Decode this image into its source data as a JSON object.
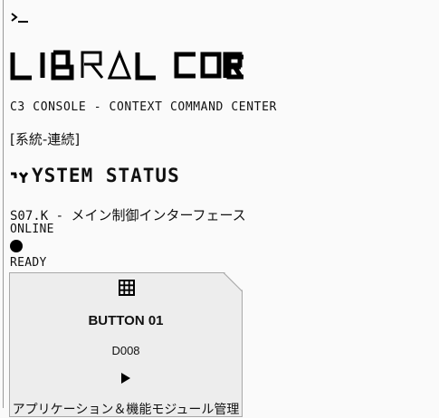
{
  "header": {
    "prompt_icon": "terminal-prompt-icon",
    "brand_logo_text": "LIBRAL CORE",
    "subtitle": "C3 CONSOLE - CONTEXT COMMAND CENTER",
    "tag": "[系統-連続]"
  },
  "system_status": {
    "heading": "YSTEM STATUS",
    "glyph_icon": "status-glyph-icon",
    "interface_code": "S07.K - ",
    "interface_name": "メイン制御インターフェース",
    "online_label": "ONLINE",
    "indicator_icon": "status-dot-icon",
    "ready_label": "READY"
  },
  "card": {
    "icon": "grid-icon",
    "title": "BUTTON 01",
    "code": "D008",
    "action_icon": "play-icon",
    "description": "アプリケーション＆機能モジュール管理"
  },
  "colors": {
    "background": "#fafafa",
    "text": "#111111",
    "card_background": "#ededed",
    "card_border": "#a8a8a8"
  }
}
